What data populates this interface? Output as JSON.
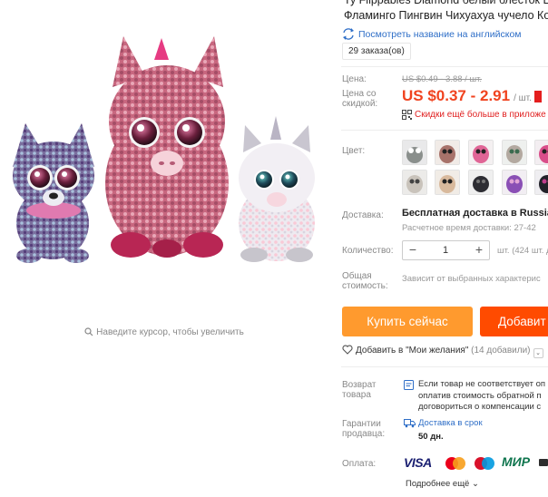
{
  "product": {
    "title_line1": "Ty Flippables Diamond белый блесток Ед",
    "title_line2": "Фламинго Пингвин Чихуахуа чучело Ко",
    "translate_link": "Посмотреть название на английском",
    "orders": "29 заказа(ов)"
  },
  "gallery": {
    "zoom_hint": "Наведите курсор, чтобы увеличить"
  },
  "price": {
    "label": "Цена:",
    "old": "US $0.49 - 3.88 / шт.",
    "discount_label": "Цена со скидкой:",
    "current": "US $0.37 - 2.91",
    "unit": "/ шт.",
    "coupon": "Скидки ещё больше в приложе"
  },
  "color": {
    "label": "Цвет:",
    "swatches": [
      "owl",
      "brown-bear",
      "pink-bear",
      "cat",
      "pink-unicorn",
      "white-owl",
      "beige-bear",
      "black-item",
      "purple-item",
      "black-cat"
    ]
  },
  "shipping": {
    "label": "Доставка:",
    "title": "Бесплатная доставка в Russian F",
    "subtitle": "Расчетное время доставки: 27-42"
  },
  "quantity": {
    "label": "Количество:",
    "value": "1",
    "stock": "шт. (424 шт. дос"
  },
  "total": {
    "label": "Общая стоимость:",
    "value": "Зависит от выбранных характерис"
  },
  "buttons": {
    "buy": "Купить сейчас",
    "cart": "Добавит"
  },
  "wishlist": {
    "label": "Добавить в \"Мои желания\"",
    "count": "(14 добавили)"
  },
  "returns": {
    "label": "Возврат товара",
    "line1": "Если товар не соответствует оп",
    "line2": "оплатив стоимость обратной п",
    "line3": "договориться о компенсации с"
  },
  "guarantee": {
    "label": "Гарантии продавца:",
    "text": "Доставка в срок",
    "days": "50 дн."
  },
  "payment": {
    "label": "Оплата:",
    "visa": "VISA",
    "mir": "МИР",
    "more": "Подробнее ещё"
  },
  "colors": {
    "accent_orange": "#ff9a2e",
    "cart_orange": "#ff4b00",
    "price_red": "#f0431f",
    "link_blue": "#2e6ec7"
  }
}
